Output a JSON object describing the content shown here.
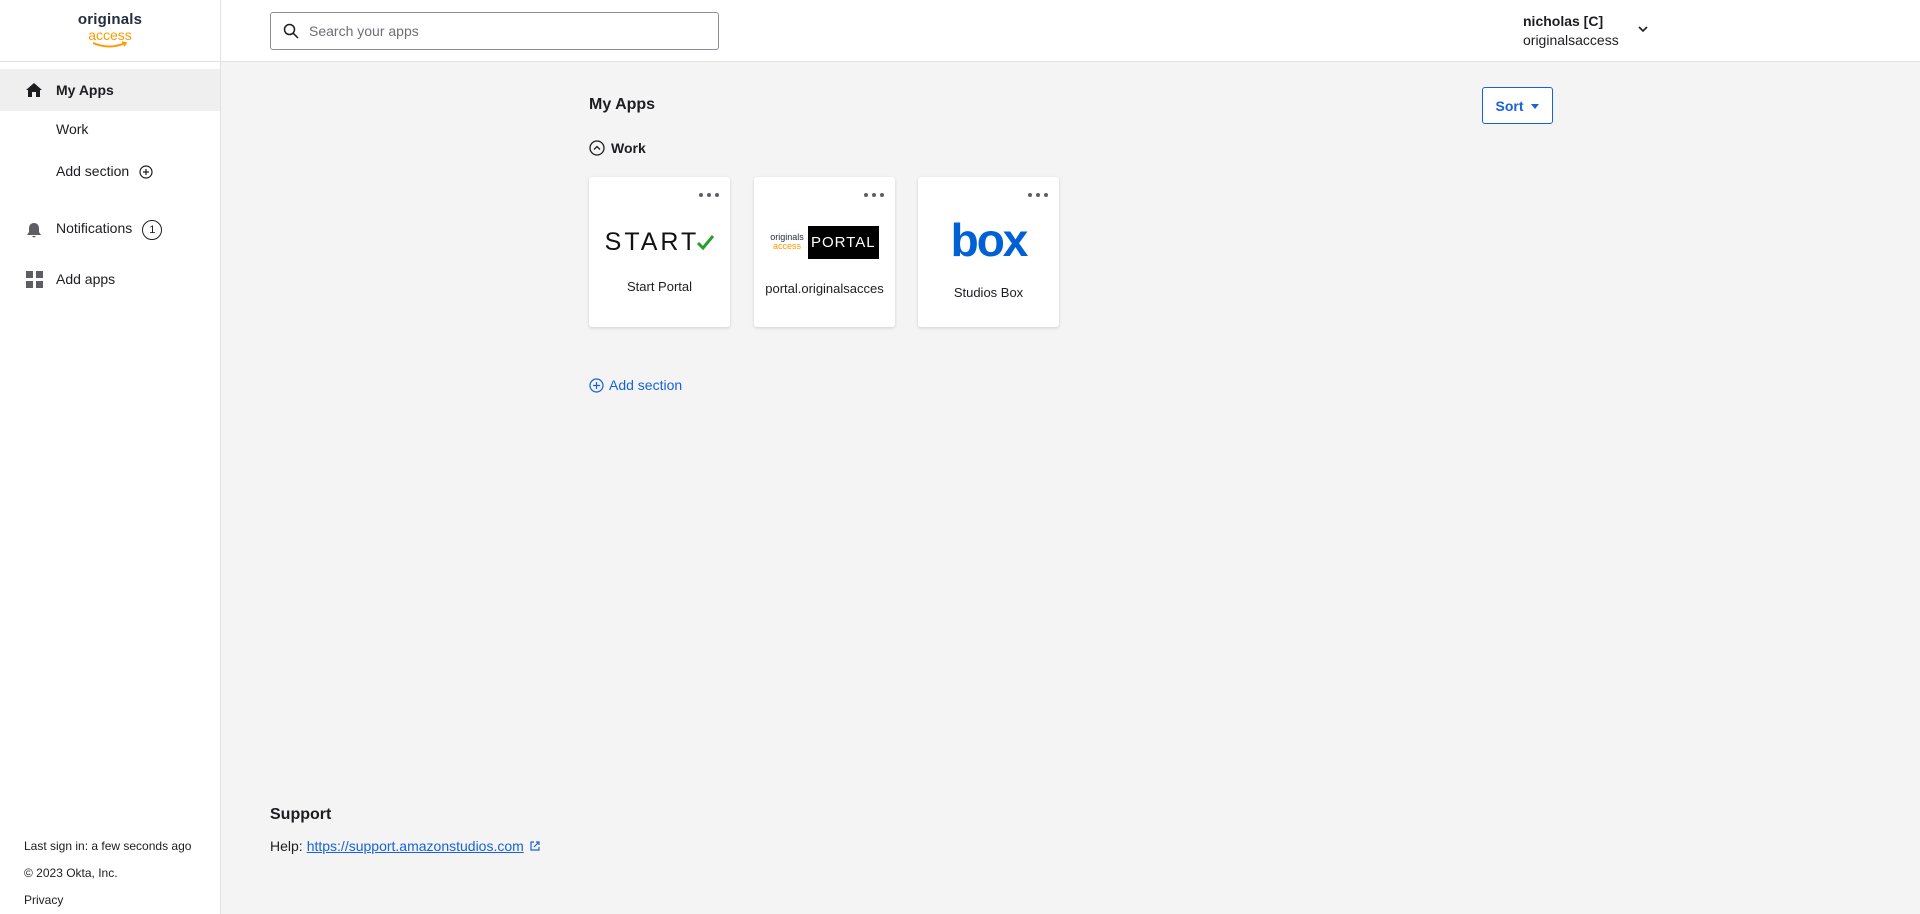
{
  "brand": {
    "logo_line1": "originals",
    "logo_line2": "access",
    "accent_color": "#1662dd",
    "orange": "#ff9900"
  },
  "sidebar": {
    "items": [
      {
        "label": "My Apps",
        "icon": "home-icon",
        "active": true
      },
      {
        "label": "Work"
      },
      {
        "label": "Add section",
        "icon": "plus-circle-icon"
      },
      {
        "label": "Notifications",
        "icon": "bell-icon",
        "badge": "1"
      },
      {
        "label": "Add apps",
        "icon": "grid-icon"
      }
    ],
    "footer": {
      "last_sign_in": "Last sign in: a few seconds ago",
      "copyright": "© 2023 Okta, Inc.",
      "privacy": "Privacy"
    }
  },
  "search": {
    "placeholder": "Search your apps",
    "value": ""
  },
  "user": {
    "name": "nicholas [C]",
    "org": "originalsaccess",
    "icon": "chevron-down-icon"
  },
  "main": {
    "title": "My Apps",
    "sort_label": "Sort",
    "section_title": "Work",
    "tiles": [
      {
        "label": "Start Portal",
        "logo_text": "START",
        "logo": "start-logo"
      },
      {
        "label": "portal.originalsacces",
        "logo_text": "PORTAL",
        "logo_small_1": "originals",
        "logo_small_2": "access",
        "logo": "portal-logo"
      },
      {
        "label": "Studios Box",
        "logo_text": "box",
        "logo": "box-logo"
      }
    ],
    "add_section_label": "Add section"
  },
  "support": {
    "title": "Support",
    "help_prefix": "Help:",
    "help_link": "https://support.amazonstudios.com"
  }
}
